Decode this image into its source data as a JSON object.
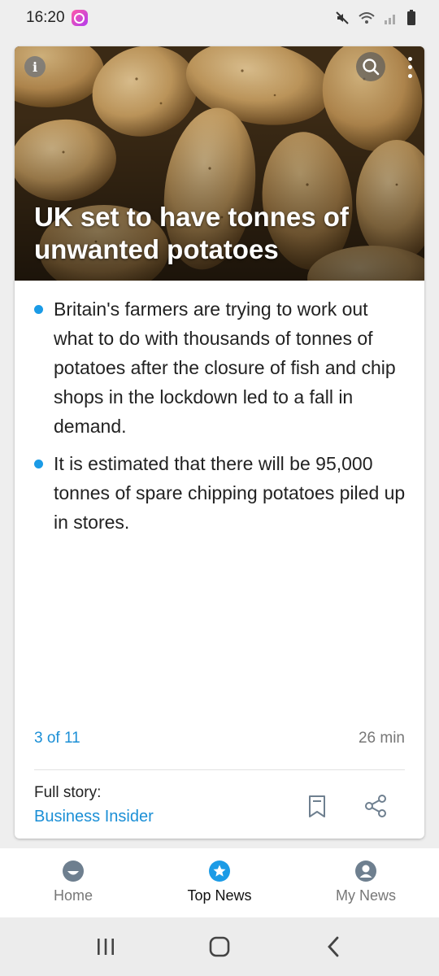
{
  "status_bar": {
    "time": "16:20",
    "icons": [
      "app-notification-icon",
      "mute-icon",
      "wifi-icon",
      "signal-icon",
      "battery-icon"
    ]
  },
  "article": {
    "headline": "UK set to have tonnes of unwanted potatoes",
    "image_icon": "potatoes-photo",
    "bullets": [
      "Britain's farmers are trying to work out what to do with thousands of tonnes of potatoes after the closure of fish and chip shops in the lockdown led to a fall in demand.",
      "It is estimated that there will be 95,000 tonnes of spare chipping potatoes piled up in stores."
    ],
    "position": "3 of 11",
    "age": "26 min",
    "full_story_label": "Full story:",
    "source": "Business Insider"
  },
  "tabs": [
    {
      "label": "Home",
      "icon": "home-face-icon",
      "active": false
    },
    {
      "label": "Top News",
      "icon": "star-icon",
      "active": true
    },
    {
      "label": "My News",
      "icon": "person-icon",
      "active": false
    }
  ],
  "colors": {
    "accent": "#1b9be6",
    "link": "#1b8fd6",
    "tab_icon_inactive": "#6e7f8f",
    "background": "#eeeeee"
  }
}
